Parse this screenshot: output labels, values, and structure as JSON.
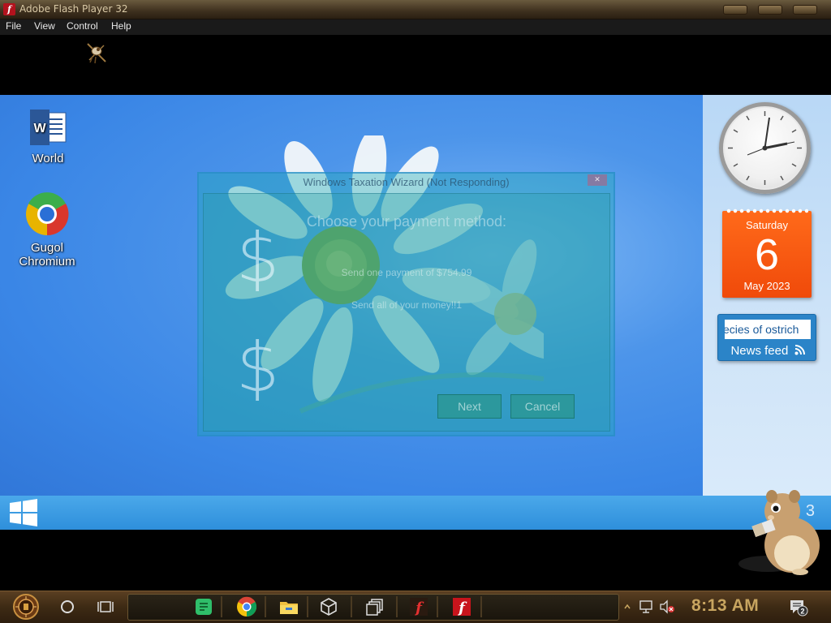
{
  "window": {
    "title": "Adobe Flash Player 32",
    "menu": [
      "File",
      "View",
      "Control",
      "Help"
    ]
  },
  "desktop": {
    "icons": [
      {
        "label_line1": "World",
        "label_line2": ""
      },
      {
        "label_line1": "Gugol",
        "label_line2": "Chromium"
      }
    ]
  },
  "wizard": {
    "title": "Windows Taxation Wizard (Not Responding)",
    "close": "✕",
    "heading": "Choose your payment method:",
    "option1": "Send one payment of $754.99",
    "option2": "Send all of your money!!1",
    "dollar_symbol": "$",
    "next_label": "Next",
    "cancel_label": "Cancel"
  },
  "gadgets": {
    "calendar": {
      "day_of_week": "Saturday",
      "day": "6",
      "month_year": "May 2023"
    },
    "news": {
      "ticker": "ecies of ostrich",
      "label": "News feed"
    }
  },
  "w8taskbar": {
    "right_fragment": "3"
  },
  "taskbar": {
    "time": "8:13 AM",
    "notification_count": "2"
  },
  "colors": {
    "desktop_blue": "#3a86e6",
    "calendar_orange": "#f04a0a",
    "news_blue": "#2b84c8",
    "taskbar_brown": "#3d2a14",
    "clock_text_gold": "#c8a560"
  }
}
